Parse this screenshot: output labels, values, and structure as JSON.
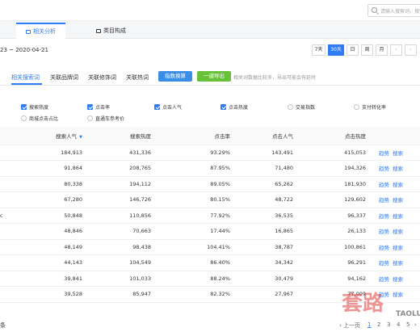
{
  "search": {
    "placeholder": "请输入搜索词，搜索词…"
  },
  "tabs": [
    {
      "label": "相关分析"
    },
    {
      "label": "类目构成"
    }
  ],
  "date": {
    "range": "23 ~ 2020-04-21",
    "periods": [
      "7天",
      "30天",
      "日",
      "周",
      "月",
      "‹",
      "›"
    ],
    "active_period": "30天"
  },
  "subtabs": [
    "相关搜索词",
    "关联品牌词",
    "关联修饰词",
    "关联热词"
  ],
  "buttons": {
    "index_convert": "指数换算",
    "export": "一键导出"
  },
  "hint": "相关词数据比较多，导出可能会有延时",
  "filters": [
    {
      "label": "搜索热度",
      "checked": true
    },
    {
      "label": "点击率",
      "checked": true
    },
    {
      "label": "点击人气",
      "checked": true
    },
    {
      "label": "点击热度",
      "checked": true
    },
    {
      "label": "交易指数",
      "checked": false
    },
    {
      "label": "支付转化率",
      "checked": false
    },
    {
      "label": "商城点击占比",
      "checked": false
    },
    {
      "label": "直通车参考价",
      "checked": false
    }
  ],
  "table": {
    "headers": [
      "搜索人气",
      "搜索热度",
      "点击率",
      "点击人气",
      "点击热度"
    ],
    "rows": [
      {
        "lead": "",
        "cells": [
          "184,913",
          "431,336",
          "93.29%",
          "143,491",
          "415,053"
        ]
      },
      {
        "lead": "",
        "cells": [
          "91,864",
          "208,765",
          "87.95%",
          "71,480",
          "194,326"
        ]
      },
      {
        "lead": "",
        "cells": [
          "80,338",
          "194,112",
          "89.05%",
          "65,262",
          "181,930"
        ]
      },
      {
        "lead": "",
        "cells": [
          "67,280",
          "146,726",
          "80.15%",
          "48,722",
          "129,602"
        ]
      },
      {
        "lead": "c",
        "cells": [
          "50,848",
          "110,856",
          "77.92%",
          "36,535",
          "96,337"
        ]
      },
      {
        "lead": "",
        "cells": [
          "48,846",
          "70,663",
          "17.44%",
          "16,865",
          "26,133"
        ]
      },
      {
        "lead": "",
        "cells": [
          "48,149",
          "98,438",
          "104.41%",
          "38,787",
          "100,861"
        ]
      },
      {
        "lead": "",
        "cells": [
          "44,143",
          "104,549",
          "86.40%",
          "34,342",
          "96,291"
        ]
      },
      {
        "lead": "",
        "cells": [
          "39,841",
          "101,033",
          "88.24%",
          "30,479",
          "94,162"
        ]
      },
      {
        "lead": "",
        "cells": [
          "39,528",
          "85,947",
          "82.32%",
          "27,967",
          "77,009"
        ]
      }
    ],
    "action_trend": "趋势",
    "action_search": "搜索"
  },
  "pager": {
    "total": "条",
    "prev": "上一页",
    "pages": [
      "1",
      "2",
      "3",
      "4",
      "5"
    ],
    "active_page": "1",
    "next": "›"
  },
  "watermark": {
    "text": "套路",
    "sub": "TAOLU"
  },
  "colors": {
    "accent": "#2f7cf6",
    "green": "#67c23a",
    "watermark": "#de3c3c"
  }
}
